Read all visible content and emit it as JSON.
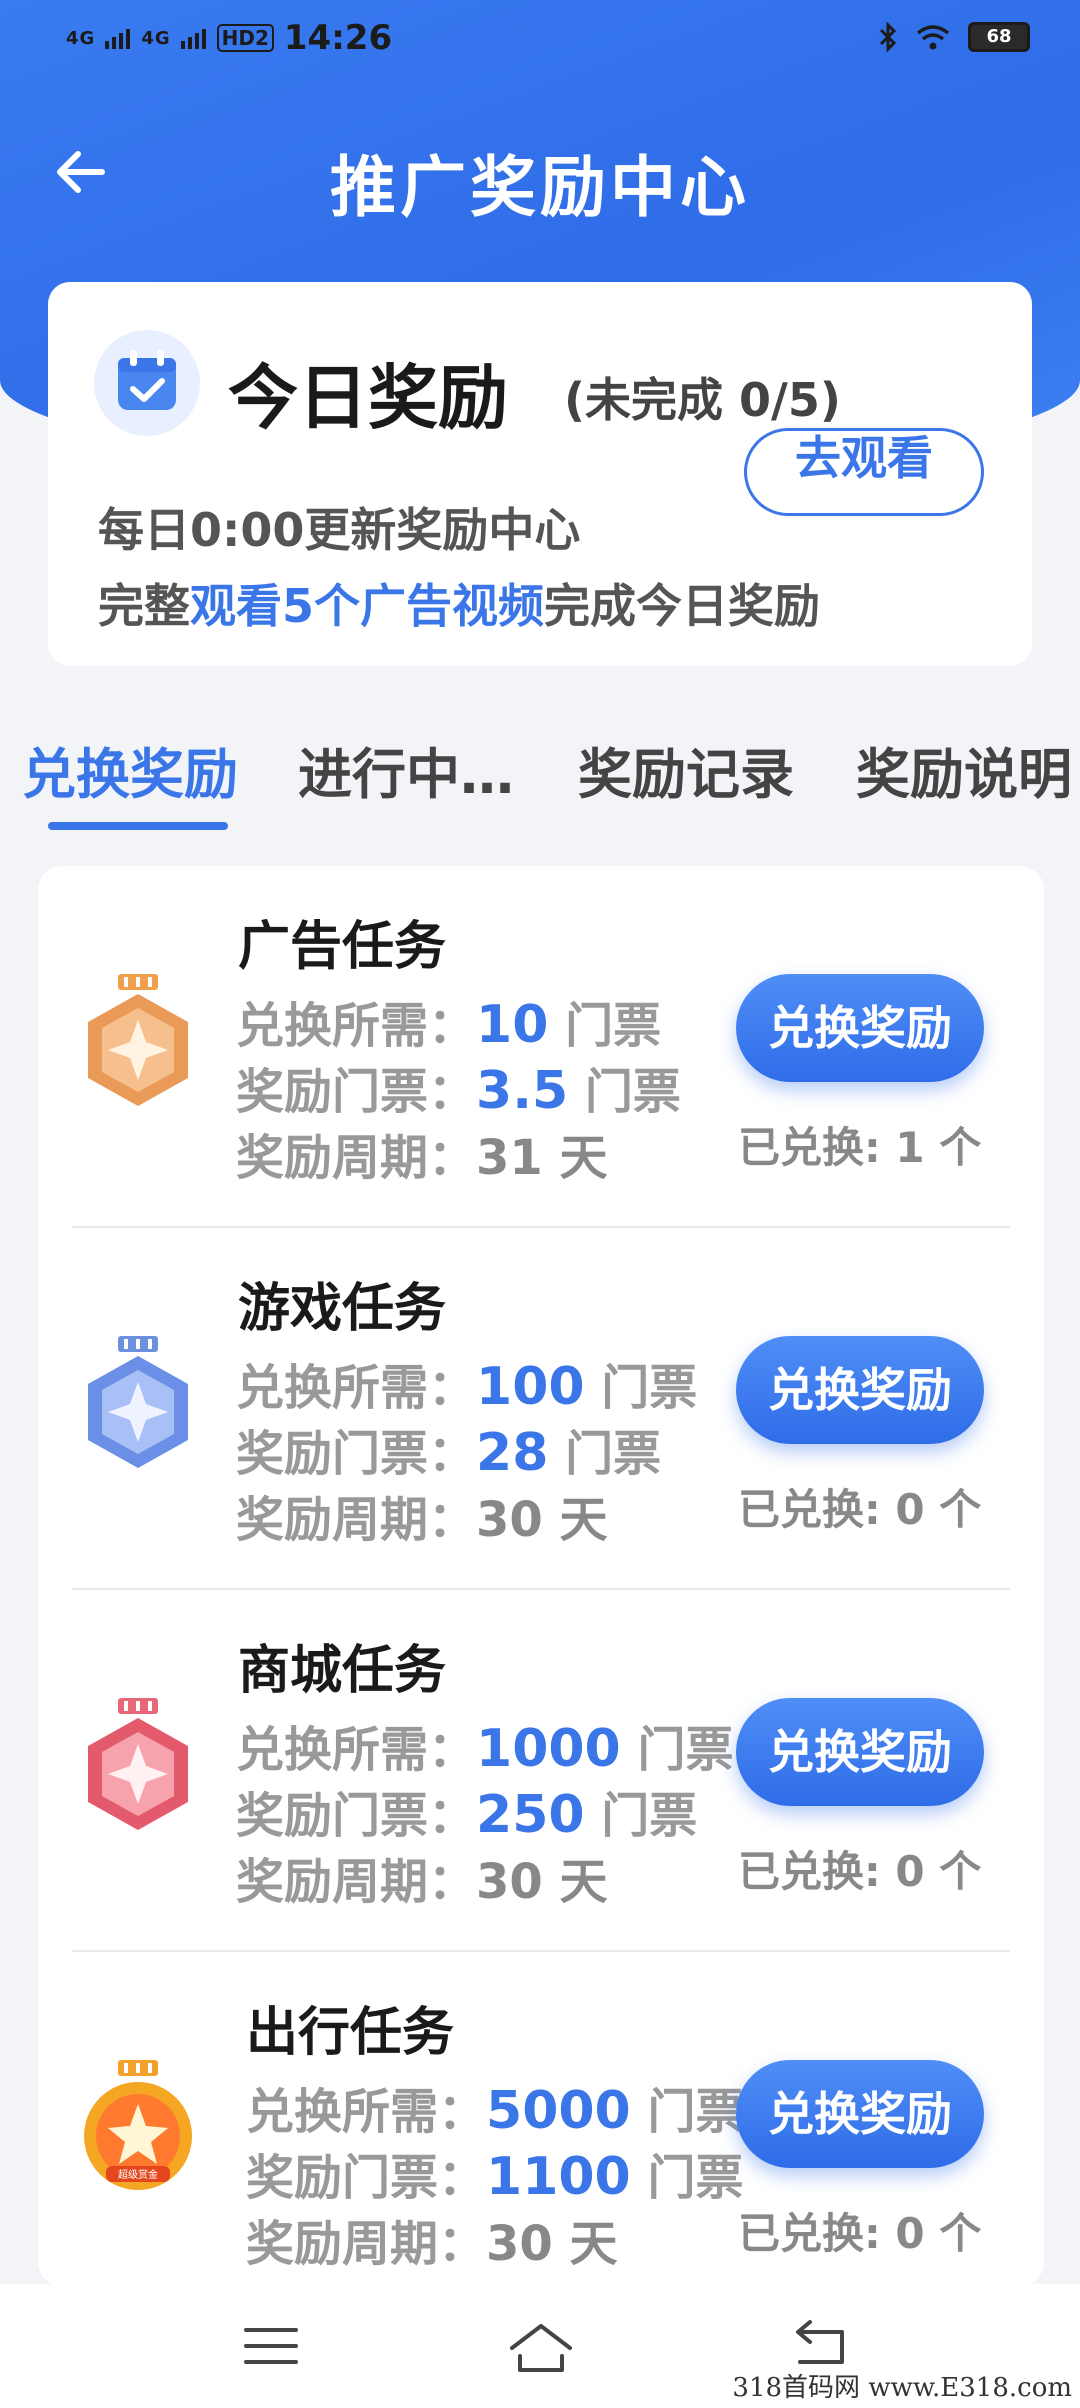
{
  "status_bar": {
    "time": "14:26",
    "net1": "4G",
    "net2": "4G",
    "hd": "HD2",
    "battery": "68"
  },
  "header": {
    "title": "推广奖励中心"
  },
  "today": {
    "title": "今日奖励",
    "status": "(未完成 0/5)",
    "watch_button": "去观看",
    "line1": "每日0:00更新奖励中心",
    "line2_prefix": "完整",
    "line2_highlight": "观看5个广告视频",
    "line2_suffix": "完成今日奖励"
  },
  "tabs": [
    {
      "label": "兑换奖励",
      "active": true
    },
    {
      "label": "进行中…",
      "active": false
    },
    {
      "label": "奖励记录",
      "active": false
    },
    {
      "label": "奖励说明",
      "active": false
    }
  ],
  "labels": {
    "cost": "兑换所需：",
    "reward": "奖励门票：",
    "cycle": "奖励周期：",
    "ticket_unit": "门票",
    "day_unit": "天",
    "redeem_button": "兑换奖励",
    "redeemed_prefix": "已兑换:",
    "count_unit": "个"
  },
  "tasks": [
    {
      "name": "广告任务",
      "cost": "10",
      "reward": "3.5",
      "cycle": "31",
      "redeemed": "1",
      "medal": "bronze-medal-icon"
    },
    {
      "name": "游戏任务",
      "cost": "100",
      "reward": "28",
      "cycle": "30",
      "redeemed": "0",
      "medal": "blue-medal-icon"
    },
    {
      "name": "商城任务",
      "cost": "1000",
      "reward": "250",
      "cycle": "30",
      "redeemed": "0",
      "medal": "pink-medal-icon"
    },
    {
      "name": "出行任务",
      "cost": "5000",
      "reward": "1100",
      "cycle": "30",
      "redeemed": "0",
      "medal": "gold-medal-icon",
      "medal_text": "超级赏金"
    }
  ],
  "watermark": "318首码网 www.E318.com",
  "colors": {
    "primary": "#3a76e8",
    "header_bg": "#2f6ce8",
    "page_bg": "#f2f4f8"
  }
}
